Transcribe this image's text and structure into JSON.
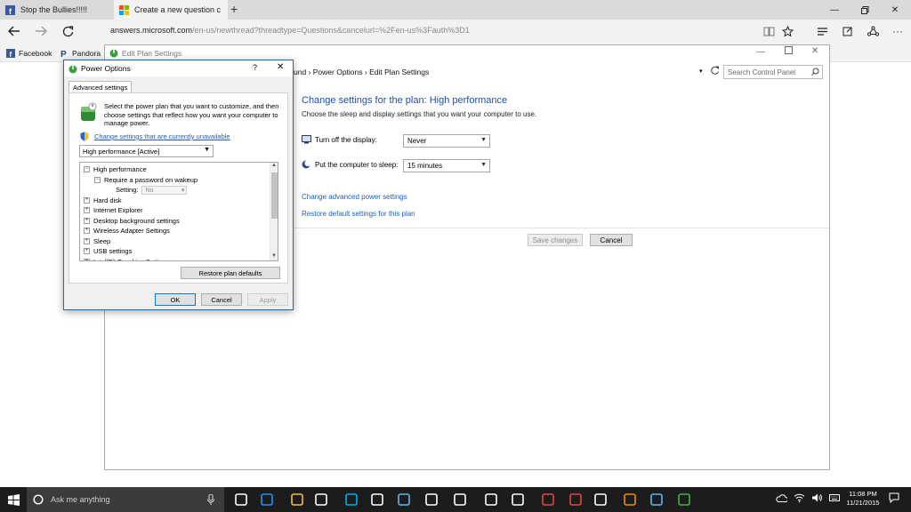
{
  "browser": {
    "tabs": [
      {
        "title": "Stop the Bullies!!!!!"
      },
      {
        "title": "Create a new question c"
      }
    ],
    "url": {
      "domain": "answers.microsoft.com",
      "path": "/en-us/newthread?threadtype=Questions&cancelurl=%2Fen-us%3Fauth%3D1",
      "scheme": ""
    },
    "favorites": [
      {
        "label": "Facebook"
      },
      {
        "label": "Pandora"
      }
    ]
  },
  "edit_plan": {
    "window_title": "Edit Plan Settings",
    "breadcrumb": "und  ›  Power Options  ›  Edit Plan Settings",
    "breadcrumb_parts": [
      "und",
      "Power Options",
      "Edit Plan Settings"
    ],
    "search_placeholder": "Search Control Panel",
    "heading": "Change settings for the plan: High performance",
    "subheading": "Choose the sleep and display settings that you want your computer to use.",
    "display_label": "Turn off the display:",
    "display_value": "Never",
    "sleep_label": "Put the computer to sleep:",
    "sleep_value": "15 minutes",
    "advanced_link": "Change advanced power settings",
    "restore_link": "Restore default settings for this plan",
    "save_label": "Save changes",
    "cancel_label": "Cancel"
  },
  "power_options": {
    "title": "Power Options",
    "help": "?",
    "tab": "Advanced settings",
    "description": "Select the power plan that you want to customize, and then choose settings that reflect how you want your computer to manage power.",
    "change_link": "Change settings that are currently unavailable",
    "plan_value": "High performance [Active]",
    "tree": [
      {
        "label": "High performance",
        "box": "−",
        "level": 0
      },
      {
        "label": "Require a password on wakeup",
        "box": "−",
        "level": 1
      },
      {
        "label": "Setting:",
        "box": "",
        "level": 2,
        "value": "No"
      },
      {
        "label": "Hard disk",
        "box": "+",
        "level": 0
      },
      {
        "label": "Internet Explorer",
        "box": "+",
        "level": 0
      },
      {
        "label": "Desktop background settings",
        "box": "+",
        "level": 0
      },
      {
        "label": "Wireless Adapter Settings",
        "box": "+",
        "level": 0
      },
      {
        "label": "Sleep",
        "box": "+",
        "level": 0
      },
      {
        "label": "USB settings",
        "box": "+",
        "level": 0
      },
      {
        "label": "Intel(R) Graphics Settings",
        "box": "+",
        "level": 0
      }
    ],
    "restore_label": "Restore plan defaults",
    "ok_label": "OK",
    "cancel_label": "Cancel",
    "apply_label": "Apply"
  },
  "taskbar": {
    "search_text": "Ask me anything",
    "time": "11:08 PM",
    "date": "11/21/2015",
    "pinned_icons": [
      "task-view-icon",
      "edge-icon",
      "file-explorer-icon",
      "store-icon",
      "skype-icon",
      "photos-icon",
      "document-icon",
      "mail-icon",
      "camera-icon",
      "settings-icon",
      "media-icon",
      "game-icon",
      "app-icon",
      "calendar-icon",
      "k-app-icon",
      "monitor-icon",
      "battery-app-icon"
    ]
  },
  "colors": {
    "accent": "#1e4ea8",
    "link": "#1e5fb5",
    "taskbar": "#1c1c1c"
  }
}
